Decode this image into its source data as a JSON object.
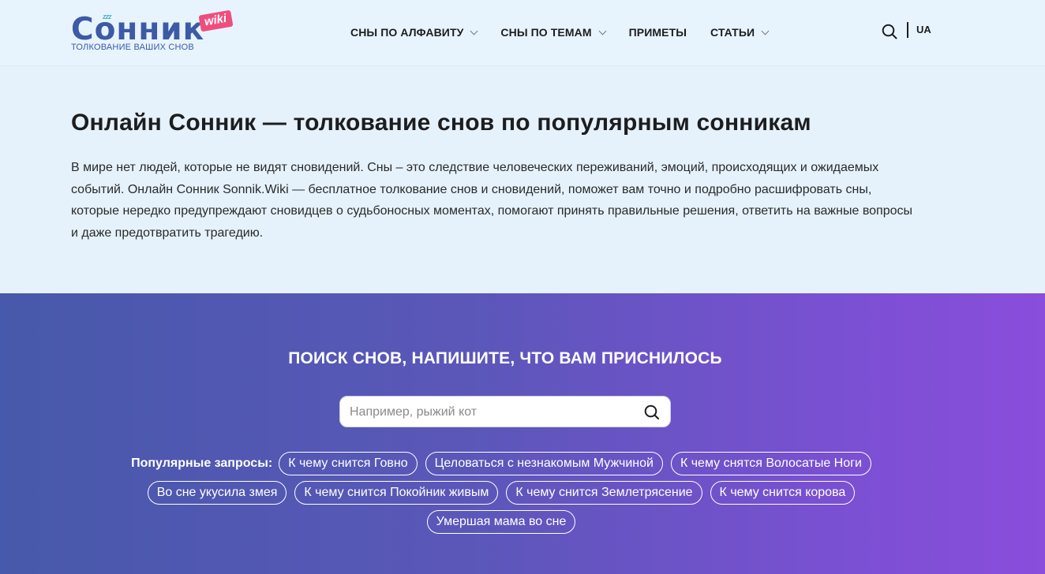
{
  "header": {
    "logo": {
      "word": "Сонник",
      "badge": "wiki",
      "zzz": "zzz",
      "tagline": "ТОЛКОВАНИЕ ВАШИХ СНОВ"
    },
    "nav": [
      {
        "label": "СНЫ ПО АЛФАВИТУ",
        "has_dropdown": true
      },
      {
        "label": "СНЫ ПО ТЕМАМ",
        "has_dropdown": true
      },
      {
        "label": "ПРИМЕТЫ",
        "has_dropdown": false
      },
      {
        "label": "СТАТЬИ",
        "has_dropdown": true
      }
    ],
    "search_icon": "search-icon",
    "lang": "UA"
  },
  "intro": {
    "title": "Онлайн Сонник — толкование снов по популярным сонникам",
    "text": "В мире нет людей, которые не видят сновидений. Сны – это следствие человеческих переживаний, эмоций, происходящих и ожидаемых событий. Онлайн Сонник Sonnik.Wiki — бесплатное толкование снов и сновидений, поможет вам точно и подробно расшифровать сны, которые нередко предупреждают сновидцев о судьбоносных моментах, помогают принять правильные решения, ответить на важные вопросы и даже предотвратить трагедию."
  },
  "search": {
    "heading": "ПОИСК СНОВ, НАПИШИТЕ, ЧТО ВАМ ПРИСНИЛОСЬ",
    "placeholder": "Например, рыжий кот",
    "value": "",
    "popular_label": "Популярные запросы:",
    "popular": [
      "К чему снится Говно",
      "Целоваться с незнакомым Мужчиной",
      "К чему снятся Волосатые Ноги",
      "Во сне укусила змея",
      "К чему снится Покойник живым",
      "К чему снится Землетрясение",
      "К чему снится корова",
      "Умершая мама во сне"
    ]
  },
  "colors": {
    "brand": "#3c5aa6",
    "badge": "#ef4d7d",
    "page_bg": "#e5f2fc",
    "gradient_start": "#4759aa",
    "gradient_end": "#8a4ddc"
  }
}
